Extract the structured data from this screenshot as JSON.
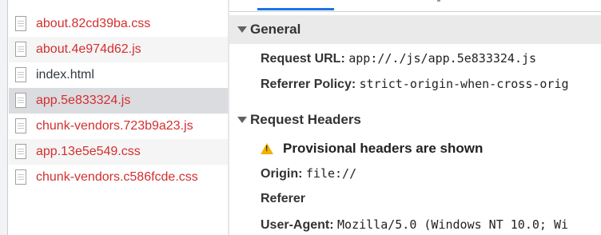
{
  "files": [
    {
      "name": "about.82cd39ba.css",
      "status": "error"
    },
    {
      "name": "about.4e974d62.js",
      "status": "error"
    },
    {
      "name": "index.html",
      "status": "ok"
    },
    {
      "name": "app.5e833324.js",
      "status": "error",
      "selected": true
    },
    {
      "name": "chunk-vendors.723b9a23.js",
      "status": "error"
    },
    {
      "name": "app.13e5e549.css",
      "status": "error"
    },
    {
      "name": "chunk-vendors.c586fcde.css",
      "status": "error"
    }
  ],
  "general": {
    "title": "General",
    "request_url_label": "Request URL:",
    "request_url": "app://./js/app.5e833324.js",
    "referrer_policy_label": "Referrer Policy:",
    "referrer_policy": "strict-origin-when-cross-orig"
  },
  "request_headers": {
    "title": "Request Headers",
    "provisional_warning": "Provisional headers are shown",
    "origin_label": "Origin:",
    "origin": "file://",
    "referer_label": "Referer",
    "user_agent_label": "User-Agent:",
    "user_agent": "Mozilla/5.0 (Windows NT 10.0; Wi"
  },
  "colors": {
    "error_text": "#d32f2f",
    "active_tab": "#1a73e8",
    "warning": "#f2b100"
  }
}
